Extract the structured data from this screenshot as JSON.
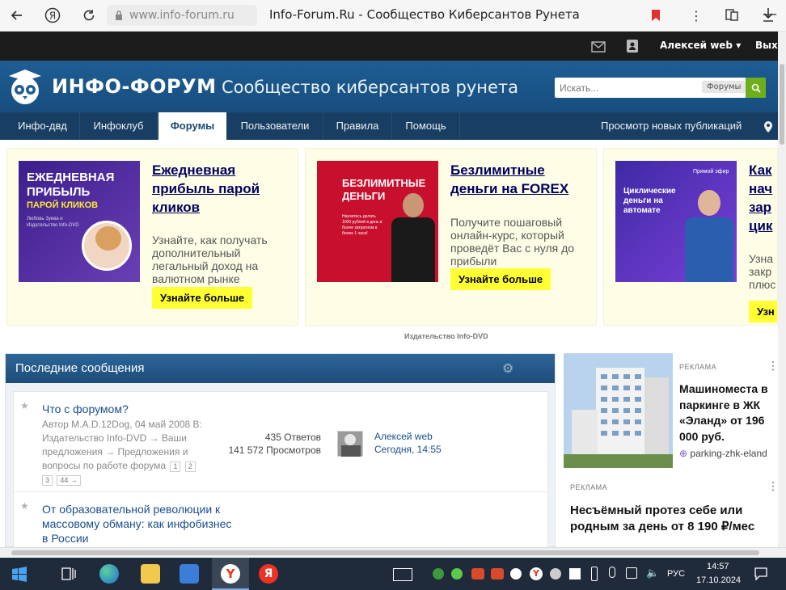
{
  "browser": {
    "url": "www.info-forum.ru",
    "title": "Info-Forum.Ru - Сообщество Киберсантов Рунета"
  },
  "topbar": {
    "user": "Алексей web",
    "exit": "Вых"
  },
  "header": {
    "logo": "ИНФО-ФОРУМ",
    "slogan": "Сообщество киберсантов рунета",
    "search_placeholder": "Искать...",
    "search_scope": "Форумы"
  },
  "nav": {
    "tabs": [
      "Инфо-двд",
      "Инфоклуб",
      "Форумы",
      "Пользователи",
      "Правила",
      "Помощь"
    ],
    "active": "Форумы",
    "right_link": "Просмотр новых публикаций"
  },
  "promos": [
    {
      "title": "Ежедневная прибыль парой кликов",
      "desc": "Узнайте, как получать дополнительный легальный доход на валютном рынке",
      "button": "Узнайте больше",
      "img_title": "ЕЖЕДНЕВНАЯ ПРИБЫЛЬ",
      "img_sub": "ПАРОЙ КЛИКОВ",
      "img_author": "Любовь Зуева и Издательство Info-DVD"
    },
    {
      "title": "Безлимитные деньги на FOREX",
      "desc": "Получите пошаговый онлайн-курс, который проведёт Вас с нуля до прибыли",
      "button": "Узнайте больше",
      "img_title": "БЕЗЛИМИТНЫЕ ДЕНЬГИ",
      "img_sub": "Научитесь делать 1000 рублей в день в более затратном в более 1 часа!"
    },
    {
      "title": "Как начать зарабатывать на циклах",
      "title_visible": "Как нач зар цик",
      "desc": "Узна закр плюс",
      "button": "Узн",
      "img_title": "Циклические деньги на автомате",
      "img_tag": "Прямой эфир"
    }
  ],
  "publisher": "Издательство Info-DVD",
  "messages": {
    "title": "Последние сообщения",
    "threads": [
      {
        "title": "Что с форумом?",
        "meta": "Автор M.A.D.12Dog, 04 май 2008 В: Издательство Info-DVD → Ваши предложения → Предложения и вопросы по работе форума",
        "pages": [
          "1",
          "2",
          "3",
          "44 →"
        ],
        "replies": "435 Ответов",
        "views": "141 572 Просмотров",
        "last_user": "Алексей web",
        "last_time": "Сегодня, 14:55"
      },
      {
        "title": "От образовательной революции к массовому обману: как инфобизнес в России"
      }
    ]
  },
  "ads": [
    {
      "label": "РЕКЛАМА",
      "text": "Машиноместа в паркинге в ЖК «Эланд» от 196 000 руб.",
      "domain": "parking-zhk-eland"
    },
    {
      "label": "РЕКЛАМА",
      "text": "Несъёмный протез себе или родным за день от 8 190 ₽/мес"
    }
  ],
  "taskbar": {
    "lang": "РУС",
    "time": "14:57",
    "date": "17.10.2024"
  },
  "colors": {
    "header": "#1e5d93",
    "nav": "#183f63",
    "promo_bg": "#fefee6",
    "promo_title": "#000060",
    "button": "#ffff33",
    "link": "#1b4d8c"
  }
}
